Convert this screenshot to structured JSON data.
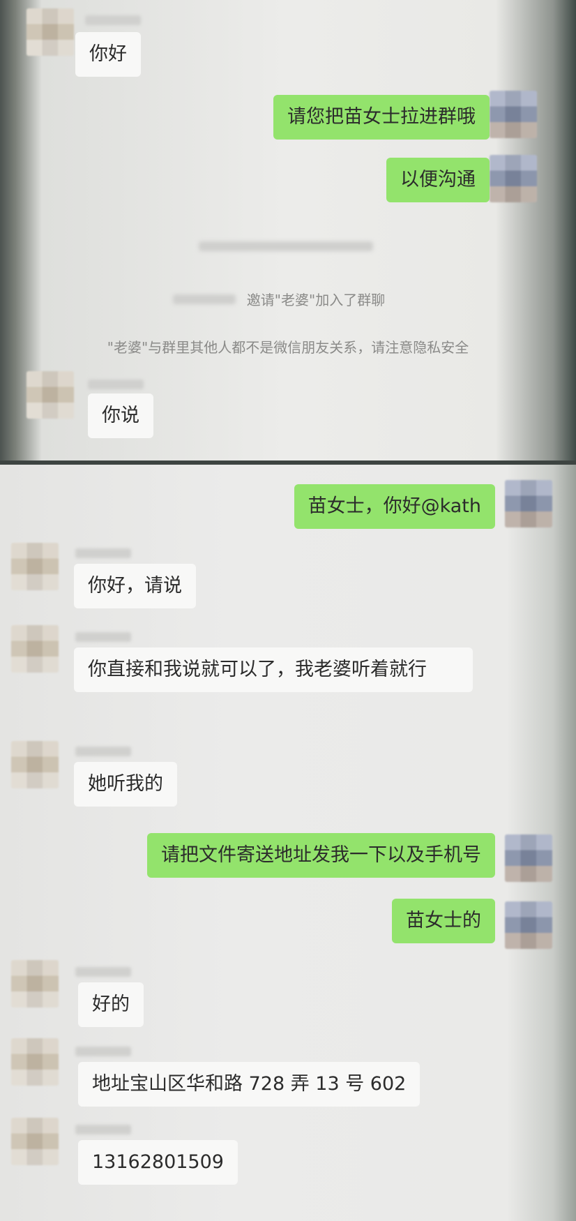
{
  "chat": {
    "screenshot_1": {
      "msg_nihao": "你好",
      "msg_invite": "请您把苗女士拉进群哦",
      "msg_goutong": "以便沟通",
      "system_joined": "邀请\"老婆\"加入了群聊",
      "system_privacy": "\"老婆\"与群里其他人都不是微信朋友关系，请注意隐私安全",
      "msg_nishuo": "你说"
    },
    "screenshot_2": {
      "msg_hello_kath": "苗女士，你好@kath",
      "msg_qingshuo": "你好，请说",
      "msg_direct": "你直接和我说就可以了，我老婆听着就行",
      "msg_tingwode": "她听我的",
      "msg_request": "请把文件寄送地址发我一下以及手机号",
      "msg_miao": "苗女士的",
      "msg_haode": "好的",
      "msg_address": "地址宝山区华和路 728 弄 13 号 602",
      "msg_phone": "13162801509"
    }
  },
  "colors": {
    "sent_bubble": "#93e36c",
    "received_bubble": "#f8f8f7",
    "background": "#e7e7e6"
  }
}
